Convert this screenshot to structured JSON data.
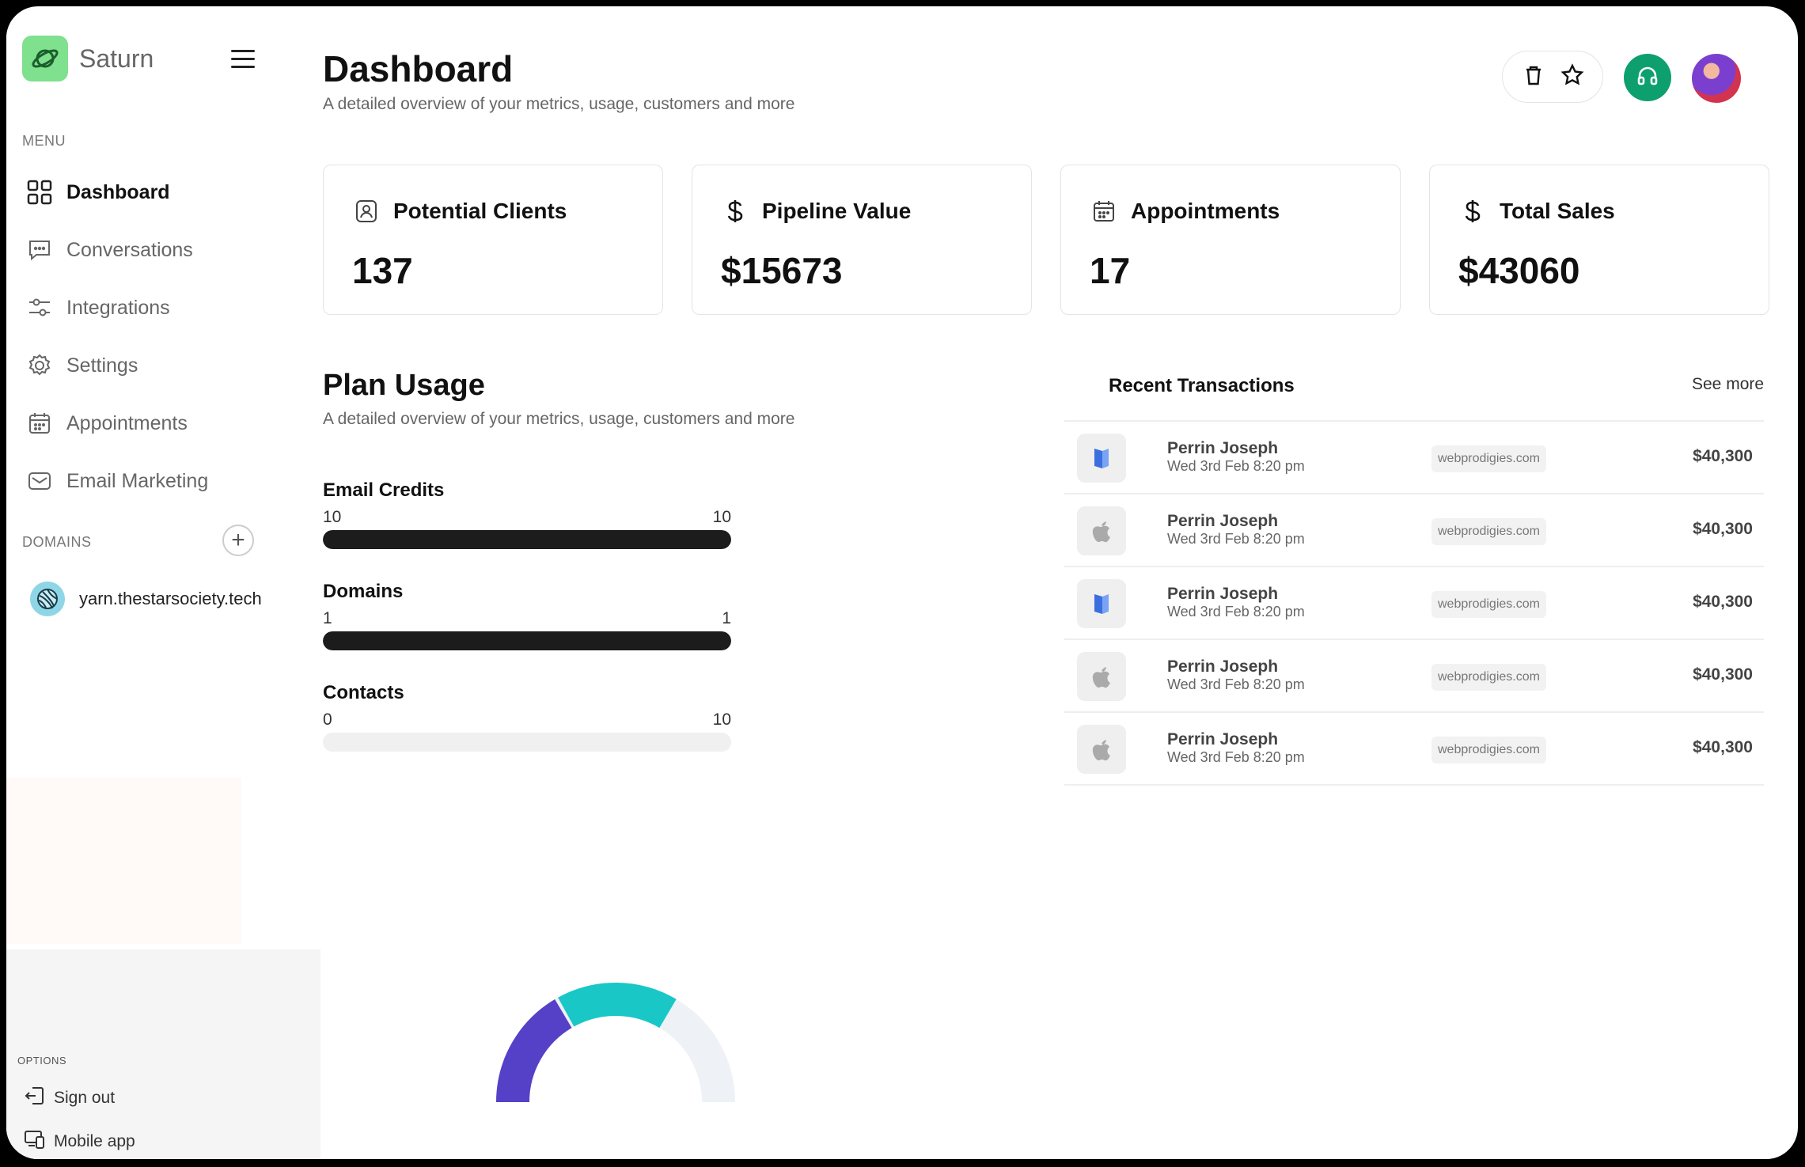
{
  "app": {
    "name": "Saturn"
  },
  "sidebar": {
    "menu_label": "MENU",
    "items": [
      {
        "label": "Dashboard",
        "icon": "grid-icon",
        "active": true
      },
      {
        "label": "Conversations",
        "icon": "chat-icon"
      },
      {
        "label": "Integrations",
        "icon": "sliders-icon"
      },
      {
        "label": "Settings",
        "icon": "gear-icon"
      },
      {
        "label": "Appointments",
        "icon": "calendar-icon"
      },
      {
        "label": "Email Marketing",
        "icon": "mail-icon"
      }
    ],
    "domains_label": "DOMAINS",
    "domains": [
      {
        "label": "yarn.thestarsociety.tech"
      }
    ],
    "options_label": "OPTIONS",
    "options": [
      {
        "label": "Sign out",
        "icon": "sign-out-icon"
      },
      {
        "label": "Mobile app",
        "icon": "devices-icon"
      }
    ]
  },
  "header": {
    "title": "Dashboard",
    "subtitle": "A detailed overview of your metrics, usage, customers and more"
  },
  "stats": [
    {
      "label": "Potential Clients",
      "value": "137",
      "icon": "contact-icon"
    },
    {
      "label": "Pipeline Value",
      "value": "$15673",
      "icon": "dollar-icon"
    },
    {
      "label": "Appointments",
      "value": "17",
      "icon": "calendar-icon"
    },
    {
      "label": "Total Sales",
      "value": "$43060",
      "icon": "dollar-icon"
    }
  ],
  "plan": {
    "title": "Plan Usage",
    "subtitle": "A detailed overview of your metrics, usage, customers and more",
    "usage": [
      {
        "name": "Email Credits",
        "used": "10",
        "limit": "10",
        "fraction": 1.0
      },
      {
        "name": "Domains",
        "used": "1",
        "limit": "1",
        "fraction": 1.0
      },
      {
        "name": "Contacts",
        "used": "0",
        "limit": "10",
        "fraction": 0.0
      }
    ],
    "gauge": {
      "segments": [
        {
          "color": "#5540c8",
          "fraction": 0.33
        },
        {
          "color": "#19c7c7",
          "fraction": 0.33
        }
      ]
    }
  },
  "transactions": {
    "title": "Recent Transactions",
    "see_more": "See more",
    "rows": [
      {
        "name": "Perrin Joseph",
        "date": "Wed 3rd Feb 8:20 pm",
        "site": "webprodigies.com",
        "amount": "$40,300",
        "icon": "book-icon"
      },
      {
        "name": "Perrin Joseph",
        "date": "Wed 3rd Feb 8:20 pm",
        "site": "webprodigies.com",
        "amount": "$40,300",
        "icon": "apple-icon"
      },
      {
        "name": "Perrin Joseph",
        "date": "Wed 3rd Feb 8:20 pm",
        "site": "webprodigies.com",
        "amount": "$40,300",
        "icon": "book-icon"
      },
      {
        "name": "Perrin Joseph",
        "date": "Wed 3rd Feb 8:20 pm",
        "site": "webprodigies.com",
        "amount": "$40,300",
        "icon": "apple-icon"
      },
      {
        "name": "Perrin Joseph",
        "date": "Wed 3rd Feb 8:20 pm",
        "site": "webprodigies.com",
        "amount": "$40,300",
        "icon": "apple-icon"
      }
    ]
  },
  "colors": {
    "brand": "#7fe08e",
    "support": "#0e9f6e",
    "bar": "#1c1c1c"
  }
}
